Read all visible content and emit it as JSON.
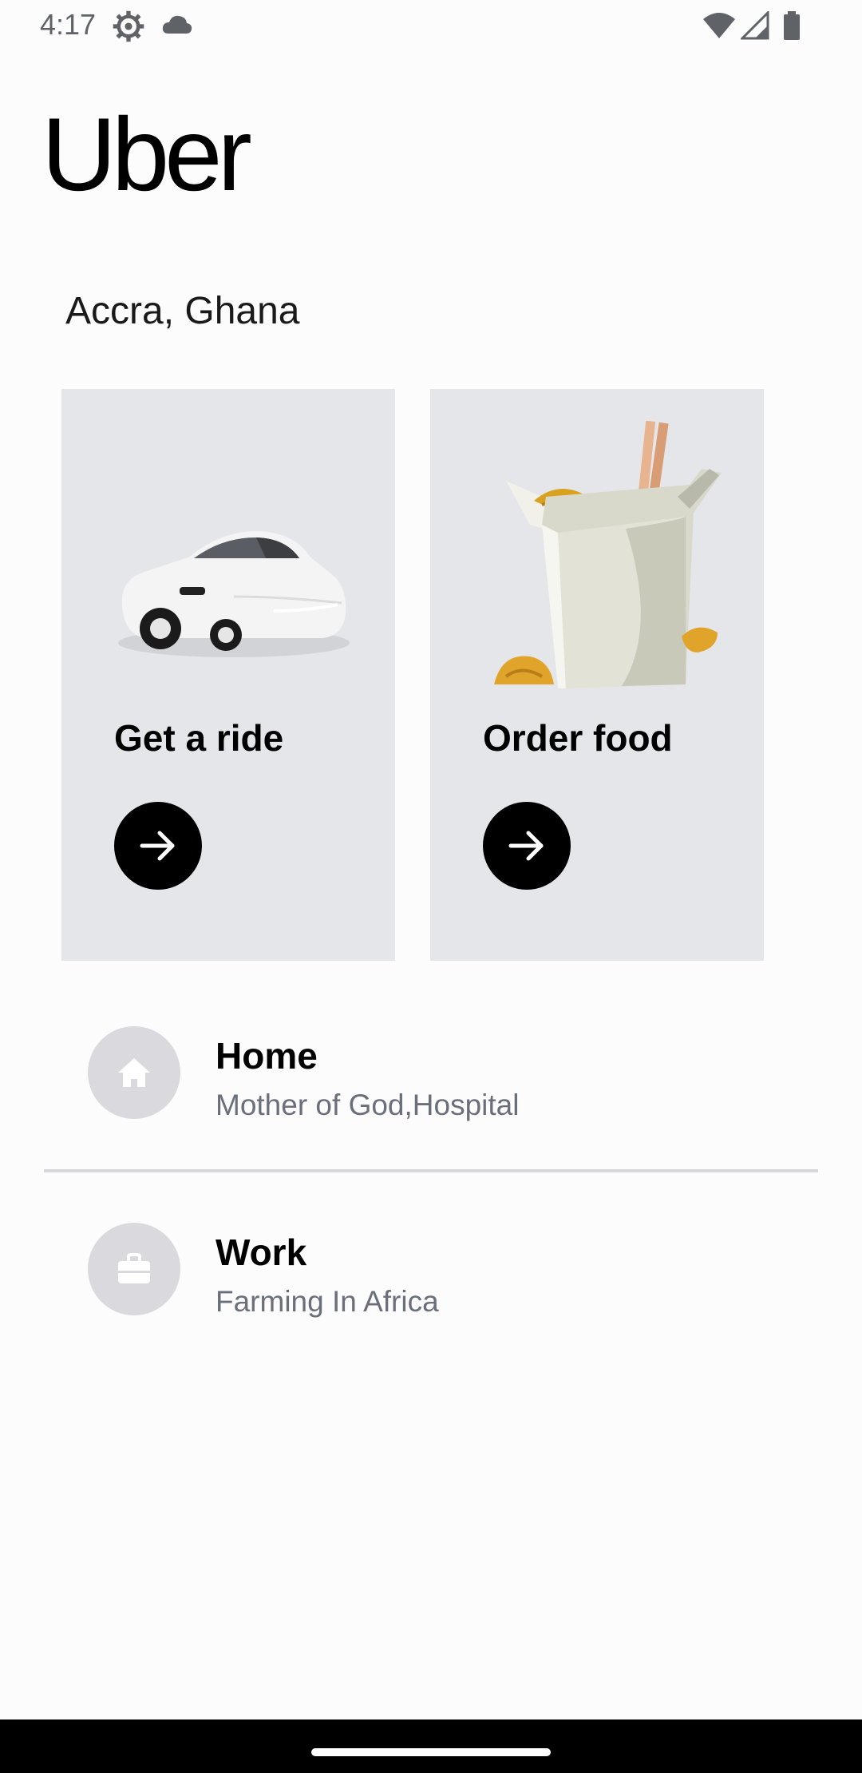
{
  "status_bar": {
    "time": "4:17",
    "icons": [
      "settings-gear-icon",
      "cloud-icon",
      "wifi-icon",
      "cell-signal-icon",
      "battery-icon"
    ]
  },
  "brand": {
    "logo_text": "Uber"
  },
  "location": {
    "city": "Accra, Ghana"
  },
  "cards": [
    {
      "title": "Get a ride",
      "illustration": "car-illustration",
      "action_icon": "arrow-right-icon"
    },
    {
      "title": "Order food",
      "illustration": "takeout-box-illustration",
      "action_icon": "arrow-right-icon"
    }
  ],
  "saved_places": [
    {
      "icon": "home-icon",
      "title": "Home",
      "subtitle": "Mother of God,Hospital"
    },
    {
      "icon": "briefcase-icon",
      "title": "Work",
      "subtitle": "Farming In Africa"
    }
  ],
  "colors": {
    "card_background": "#e5e6ea",
    "icon_circle": "#d9d9de",
    "subtitle_text": "#6b6f7b",
    "divider": "#d6d8dc",
    "accent": "#000000"
  }
}
